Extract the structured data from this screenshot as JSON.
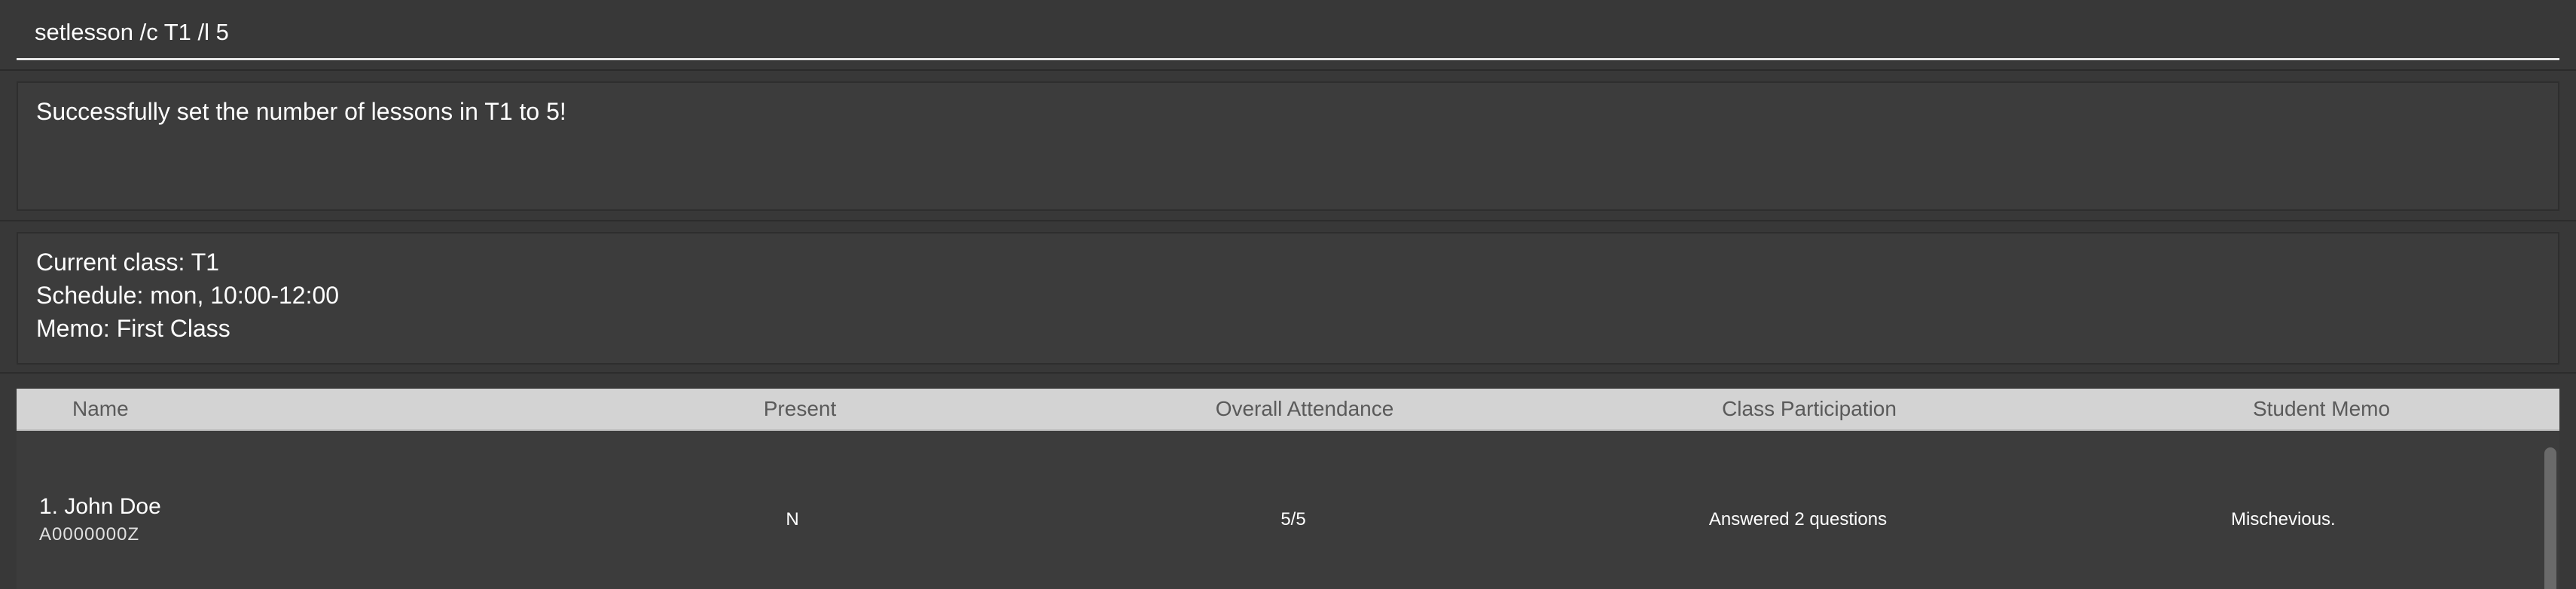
{
  "command": {
    "value": "setlesson /c T1 /l 5"
  },
  "result": {
    "message": "Successfully set the number of lessons in T1 to 5!"
  },
  "class_info": {
    "current_class": "Current class: T1",
    "schedule": "Schedule: mon, 10:00-12:00",
    "memo": "Memo: First Class"
  },
  "table": {
    "headers": {
      "name": "Name",
      "present": "Present",
      "overall": "Overall Attendance",
      "participation": "Class Participation",
      "memo": "Student Memo"
    },
    "rows": [
      {
        "name": "1.  John Doe",
        "id": "A0000000Z",
        "present": "N",
        "overall": "5/5",
        "participation": "Answered 2 questions",
        "memo": "Mischevious."
      }
    ]
  }
}
